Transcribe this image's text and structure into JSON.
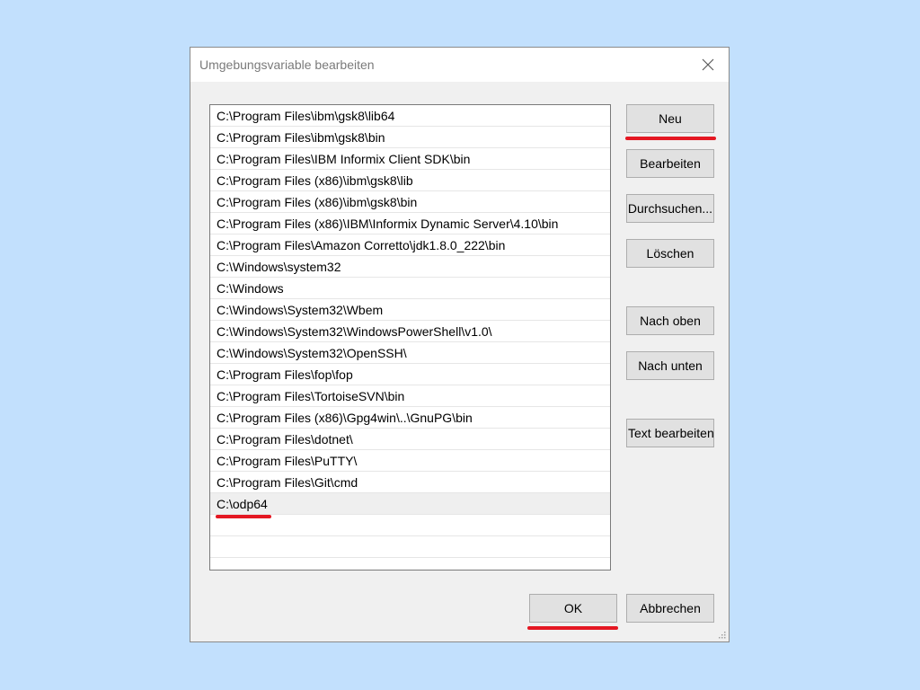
{
  "dialog": {
    "title": "Umgebungsvariable bearbeiten",
    "close_icon": "close-icon"
  },
  "paths": [
    "C:\\Program Files\\ibm\\gsk8\\lib64",
    "C:\\Program Files\\ibm\\gsk8\\bin",
    "C:\\Program Files\\IBM Informix Client SDK\\bin",
    "C:\\Program Files (x86)\\ibm\\gsk8\\lib",
    "C:\\Program Files (x86)\\ibm\\gsk8\\bin",
    "C:\\Program Files (x86)\\IBM\\Informix Dynamic Server\\4.10\\bin",
    "C:\\Program Files\\Amazon Corretto\\jdk1.8.0_222\\bin",
    "C:\\Windows\\system32",
    "C:\\Windows",
    "C:\\Windows\\System32\\Wbem",
    "C:\\Windows\\System32\\WindowsPowerShell\\v1.0\\",
    "C:\\Windows\\System32\\OpenSSH\\",
    "C:\\Program Files\\fop\\fop",
    "C:\\Program Files\\TortoiseSVN\\bin",
    "C:\\Program Files (x86)\\Gpg4win\\..\\GnuPG\\bin",
    "C:\\Program Files\\dotnet\\",
    "C:\\Program Files\\PuTTY\\",
    "C:\\Program Files\\Git\\cmd",
    "C:\\odp64"
  ],
  "buttons": {
    "new": "Neu",
    "edit": "Bearbeiten",
    "browse": "Durchsuchen...",
    "delete": "Löschen",
    "move_up": "Nach oben",
    "move_down": "Nach unten",
    "edit_text": "Text bearbeiten...",
    "ok": "OK",
    "cancel": "Abbrechen"
  },
  "colors": {
    "background": "#c2e0fd",
    "highlight": "#e41722",
    "button_face": "#e1e1e1"
  }
}
